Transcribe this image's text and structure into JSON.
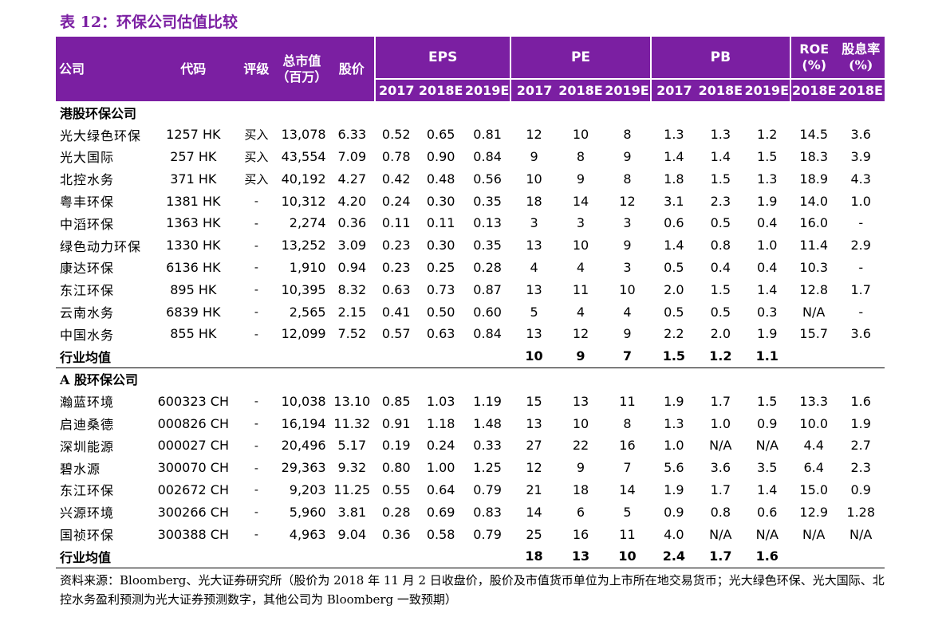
{
  "title": "表 12：环保公司估值比较",
  "header": {
    "company": "公司",
    "code": "代码",
    "rating": "评级",
    "mktcap_l1": "总市值",
    "mktcap_l2": "（百万）",
    "price": "股价",
    "eps": "EPS",
    "pe": "PE",
    "pb": "PB",
    "roe_l1": "ROE",
    "roe_l2": "(%)",
    "div_l1": "股息率",
    "div_l2": "(%)",
    "y2017": "2017",
    "y2018e": "2018E",
    "y2019e": "2019E"
  },
  "sections": [
    {
      "name": "港股环保公司",
      "rows": [
        {
          "company": "光大绿色环保",
          "code": "1257 HK",
          "rating": "买入",
          "mktcap": "13,078",
          "price": "6.33",
          "eps": [
            "0.52",
            "0.65",
            "0.81"
          ],
          "pe": [
            "12",
            "10",
            "8"
          ],
          "pb": [
            "1.3",
            "1.3",
            "1.2"
          ],
          "roe": "14.5",
          "div": "3.6"
        },
        {
          "company": "光大国际",
          "code": "257 HK",
          "rating": "买入",
          "mktcap": "43,554",
          "price": "7.09",
          "eps": [
            "0.78",
            "0.90",
            "0.84"
          ],
          "pe": [
            "9",
            "8",
            "9"
          ],
          "pb": [
            "1.4",
            "1.4",
            "1.5"
          ],
          "roe": "18.3",
          "div": "3.9"
        },
        {
          "company": "北控水务",
          "code": "371 HK",
          "rating": "买入",
          "mktcap": "40,192",
          "price": "4.27",
          "eps": [
            "0.42",
            "0.48",
            "0.56"
          ],
          "pe": [
            "10",
            "9",
            "8"
          ],
          "pb": [
            "1.8",
            "1.5",
            "1.3"
          ],
          "roe": "18.9",
          "div": "4.3"
        },
        {
          "company": "粤丰环保",
          "code": "1381 HK",
          "rating": "-",
          "mktcap": "10,312",
          "price": "4.20",
          "eps": [
            "0.24",
            "0.30",
            "0.35"
          ],
          "pe": [
            "18",
            "14",
            "12"
          ],
          "pb": [
            "3.1",
            "2.3",
            "1.9"
          ],
          "roe": "14.0",
          "div": "1.0"
        },
        {
          "company": "中滔环保",
          "code": "1363 HK",
          "rating": "-",
          "mktcap": "2,274",
          "price": "0.36",
          "eps": [
            "0.11",
            "0.11",
            "0.13"
          ],
          "pe": [
            "3",
            "3",
            "3"
          ],
          "pb": [
            "0.6",
            "0.5",
            "0.4"
          ],
          "roe": "16.0",
          "div": "-"
        },
        {
          "company": "绿色动力环保",
          "code": "1330 HK",
          "rating": "-",
          "mktcap": "13,252",
          "price": "3.09",
          "eps": [
            "0.23",
            "0.30",
            "0.35"
          ],
          "pe": [
            "13",
            "10",
            "9"
          ],
          "pb": [
            "1.4",
            "0.8",
            "1.0"
          ],
          "roe": "11.4",
          "div": "2.9"
        },
        {
          "company": "康达环保",
          "code": "6136 HK",
          "rating": "-",
          "mktcap": "1,910",
          "price": "0.94",
          "eps": [
            "0.23",
            "0.25",
            "0.28"
          ],
          "pe": [
            "4",
            "4",
            "3"
          ],
          "pb": [
            "0.5",
            "0.4",
            "0.4"
          ],
          "roe": "10.3",
          "div": "-"
        },
        {
          "company": "东江环保",
          "code": "895 HK",
          "rating": "-",
          "mktcap": "10,395",
          "price": "8.32",
          "eps": [
            "0.63",
            "0.73",
            "0.87"
          ],
          "pe": [
            "13",
            "11",
            "10"
          ],
          "pb": [
            "2.0",
            "1.5",
            "1.4"
          ],
          "roe": "12.8",
          "div": "1.7"
        },
        {
          "company": "云南水务",
          "code": "6839 HK",
          "rating": "-",
          "mktcap": "2,565",
          "price": "2.15",
          "eps": [
            "0.41",
            "0.50",
            "0.60"
          ],
          "pe": [
            "5",
            "4",
            "4"
          ],
          "pb": [
            "0.5",
            "0.5",
            "0.3"
          ],
          "roe": "N/A",
          "div": "-"
        },
        {
          "company": "中国水务",
          "code": "855 HK",
          "rating": "-",
          "mktcap": "12,099",
          "price": "7.52",
          "eps": [
            "0.57",
            "0.63",
            "0.84"
          ],
          "pe": [
            "13",
            "12",
            "9"
          ],
          "pb": [
            "2.2",
            "2.0",
            "1.9"
          ],
          "roe": "15.7",
          "div": "3.6"
        }
      ],
      "average": {
        "label": "行业均值",
        "pe": [
          "10",
          "9",
          "7"
        ],
        "pb": [
          "1.5",
          "1.2",
          "1.1"
        ]
      }
    },
    {
      "name": "A 股环保公司",
      "rows": [
        {
          "company": "瀚蓝环境",
          "code": "600323 CH",
          "rating": "-",
          "mktcap": "10,038",
          "price": "13.10",
          "eps": [
            "0.85",
            "1.03",
            "1.19"
          ],
          "pe": [
            "15",
            "13",
            "11"
          ],
          "pb": [
            "1.9",
            "1.7",
            "1.5"
          ],
          "roe": "13.3",
          "div": "1.6"
        },
        {
          "company": "启迪桑德",
          "code": "000826 CH",
          "rating": "-",
          "mktcap": "16,194",
          "price": "11.32",
          "eps": [
            "0.91",
            "1.18",
            "1.48"
          ],
          "pe": [
            "13",
            "10",
            "8"
          ],
          "pb": [
            "1.3",
            "1.0",
            "0.9"
          ],
          "roe": "10.0",
          "div": "1.9"
        },
        {
          "company": "深圳能源",
          "code": "000027 CH",
          "rating": "-",
          "mktcap": "20,496",
          "price": "5.17",
          "eps": [
            "0.19",
            "0.24",
            "0.33"
          ],
          "pe": [
            "27",
            "22",
            "16"
          ],
          "pb": [
            "1.0",
            "N/A",
            "N/A"
          ],
          "roe": "4.4",
          "div": "2.7"
        },
        {
          "company": "碧水源",
          "code": "300070 CH",
          "rating": "-",
          "mktcap": "29,363",
          "price": "9.32",
          "eps": [
            "0.80",
            "1.00",
            "1.25"
          ],
          "pe": [
            "12",
            "9",
            "7"
          ],
          "pb": [
            "5.6",
            "3.6",
            "3.5"
          ],
          "roe": "6.4",
          "div": "2.3"
        },
        {
          "company": "东江环保",
          "code": "002672 CH",
          "rating": "-",
          "mktcap": "9,203",
          "price": "11.25",
          "eps": [
            "0.55",
            "0.64",
            "0.79"
          ],
          "pe": [
            "21",
            "18",
            "14"
          ],
          "pb": [
            "1.9",
            "1.7",
            "1.4"
          ],
          "roe": "15.0",
          "div": "0.9"
        },
        {
          "company": "兴源环境",
          "code": "300266 CH",
          "rating": "-",
          "mktcap": "5,960",
          "price": "3.81",
          "eps": [
            "0.28",
            "0.69",
            "0.83"
          ],
          "pe": [
            "14",
            "6",
            "5"
          ],
          "pb": [
            "0.9",
            "0.8",
            "0.6"
          ],
          "roe": "12.9",
          "div": "1.28"
        },
        {
          "company": "国祯环保",
          "code": "300388 CH",
          "rating": "-",
          "mktcap": "4,963",
          "price": "9.04",
          "eps": [
            "0.36",
            "0.58",
            "0.79"
          ],
          "pe": [
            "25",
            "16",
            "11"
          ],
          "pb": [
            "4.0",
            "N/A",
            "N/A"
          ],
          "roe": "N/A",
          "div": "N/A"
        }
      ],
      "average": {
        "label": "行业均值",
        "pe": [
          "18",
          "13",
          "10"
        ],
        "pb": [
          "2.4",
          "1.7",
          "1.6"
        ]
      }
    }
  ],
  "source": "资料来源：Bloomberg、光大证券研究所（股价为 2018 年 11 月 2 日收盘价，股价及市值货币单位为上市所在地交易货币；光大绿色环保、光大国际、北控水务盈利预测为光大证券预测数字，其他公司为 Bloomberg 一致预期）",
  "colors": {
    "header_bg": "#7b1fa2",
    "title": "#7b1fa2"
  }
}
